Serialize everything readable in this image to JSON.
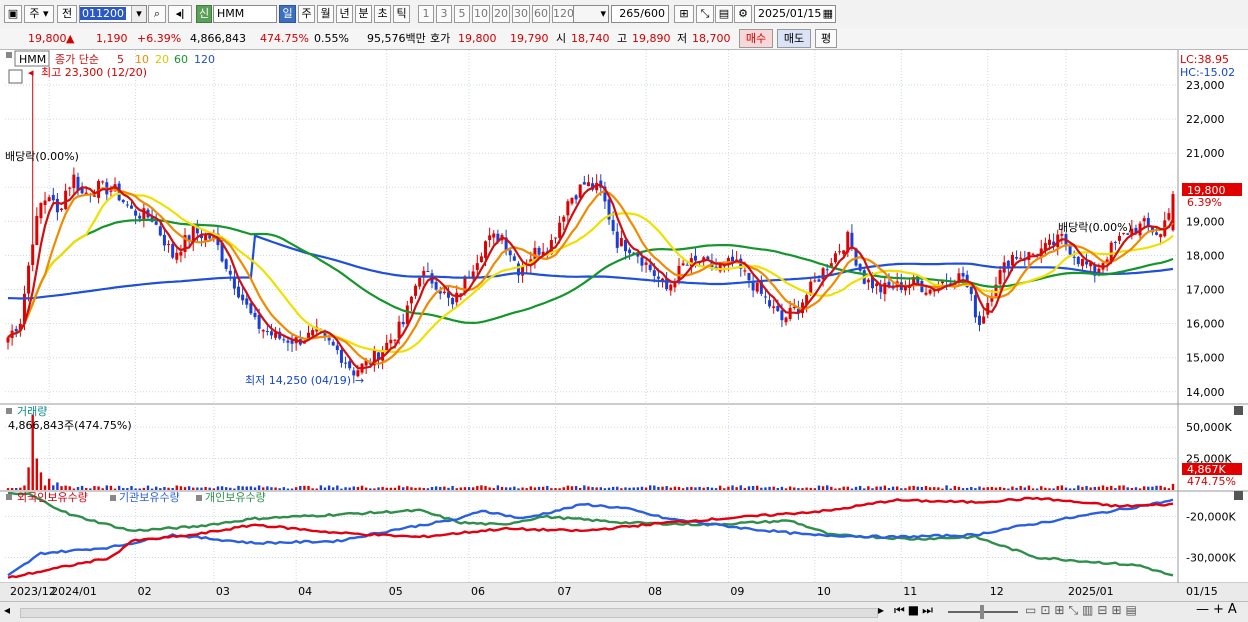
{
  "toolbar": {
    "market_label": "주",
    "prev_label": "전",
    "stock_code": "011200",
    "badge_label": "신",
    "stock_name": "HMM",
    "period_tabs": [
      "일",
      "주",
      "월",
      "년",
      "분",
      "초",
      "틱"
    ],
    "active_period": "일",
    "interval_buttons": [
      "1",
      "3",
      "5",
      "10",
      "20",
      "30",
      "60",
      "120"
    ],
    "count_value": "265",
    "count_max": "/600",
    "date_value": "2025/01/15"
  },
  "quote": {
    "price": "19,800",
    "change_arrow": "▲",
    "change": "1,190",
    "change_pct": "+6.39%",
    "volume": "4,866,843",
    "volume_ratio": "474.75%",
    "turnover": "0.55%",
    "amount": "95,576백만",
    "hoga_label": "호가",
    "ask": "19,800",
    "bid": "19,790",
    "open_label": "시",
    "open": "18,740",
    "high_label": "고",
    "high": "19,890",
    "low_label": "저",
    "low": "18,700",
    "buy_label": "매수",
    "sell_label": "매도",
    "eval_label": "평"
  },
  "colors": {
    "up": "#e00000",
    "down": "#1a3fd6",
    "ma5": "#d01010",
    "ma10": "#f08a00",
    "ma20": "#f0e000",
    "ma60": "#14962a",
    "ma120": "#2050d8",
    "foreign": "#e00010",
    "institution": "#2a5fe0",
    "individual": "#2f8f4a"
  },
  "chart_data": [
    {
      "type": "candlestick",
      "title": "HMM",
      "legend": [
        "종가 단순",
        "5",
        "10",
        "20",
        "60",
        "120"
      ],
      "corner_labels": [
        "LC:38.95",
        "HC:-15.02"
      ],
      "ylim": [
        13700,
        23500
      ],
      "yticks": [
        14000,
        15000,
        16000,
        17000,
        18000,
        19000,
        20000,
        21000,
        22000,
        23000
      ],
      "ytick_labels": [
        "14,000",
        "15,000",
        "16,000",
        "17,000",
        "18,000",
        "19,000",
        "20,000",
        "21,000",
        "22,000",
        "23,000"
      ],
      "annotations": {
        "high": "최고 23,300 (12/20)",
        "low": "최저 14,250 (04/19)",
        "dividend1": "배당락(0.00%)",
        "dividend2": "배당락(0.00%)"
      },
      "last_price_label": "19,800",
      "last_change_label": "6.39%",
      "months": [
        "2023/12",
        "2024/01",
        "02",
        "03",
        "04",
        "05",
        "06",
        "07",
        "08",
        "09",
        "10",
        "11",
        "12",
        "2025/01",
        "01/15"
      ],
      "close_anchors": [
        [
          0,
          15600
        ],
        [
          3,
          16100
        ],
        [
          6,
          18500
        ],
        [
          8,
          19500
        ],
        [
          10,
          19800
        ],
        [
          12,
          19200
        ],
        [
          14,
          19900
        ],
        [
          16,
          20300
        ],
        [
          18,
          19800
        ],
        [
          22,
          20000
        ],
        [
          26,
          19900
        ],
        [
          30,
          19300
        ],
        [
          35,
          19100
        ],
        [
          40,
          18000
        ],
        [
          45,
          18700
        ],
        [
          50,
          18500
        ],
        [
          55,
          17200
        ],
        [
          60,
          16000
        ],
        [
          65,
          15600
        ],
        [
          70,
          15500
        ],
        [
          75,
          15700
        ],
        [
          80,
          15200
        ],
        [
          84,
          14600
        ],
        [
          88,
          14900
        ],
        [
          92,
          15400
        ],
        [
          96,
          16000
        ],
        [
          100,
          17500
        ],
        [
          104,
          17200
        ],
        [
          108,
          16500
        ],
        [
          112,
          17500
        ],
        [
          116,
          18400
        ],
        [
          120,
          18600
        ],
        [
          124,
          17600
        ],
        [
          128,
          18100
        ],
        [
          132,
          18400
        ],
        [
          136,
          19600
        ],
        [
          140,
          20100
        ],
        [
          144,
          19900
        ],
        [
          148,
          18400
        ],
        [
          152,
          18200
        ],
        [
          156,
          17600
        ],
        [
          160,
          17000
        ],
        [
          164,
          17700
        ],
        [
          168,
          17800
        ],
        [
          172,
          17600
        ],
        [
          176,
          17800
        ],
        [
          180,
          17300
        ],
        [
          184,
          16700
        ],
        [
          188,
          16100
        ],
        [
          192,
          16500
        ],
        [
          196,
          17200
        ],
        [
          200,
          17900
        ],
        [
          204,
          18500
        ],
        [
          208,
          17300
        ],
        [
          212,
          17000
        ],
        [
          216,
          17100
        ],
        [
          220,
          17200
        ],
        [
          224,
          17000
        ],
        [
          228,
          17300
        ],
        [
          232,
          17400
        ],
        [
          236,
          16000
        ],
        [
          240,
          17300
        ],
        [
          244,
          18000
        ],
        [
          248,
          18000
        ],
        [
          252,
          18200
        ],
        [
          256,
          18500
        ],
        [
          260,
          17900
        ],
        [
          264,
          17500
        ],
        [
          268,
          18200
        ],
        [
          272,
          18700
        ],
        [
          276,
          18900
        ],
        [
          280,
          18600
        ],
        [
          283,
          19800
        ]
      ]
    },
    {
      "type": "bar",
      "title": "거래량",
      "value_label": "4,866,843주(474.75%)",
      "yticks": [
        25000,
        50000
      ],
      "ytick_labels": [
        "25,000K",
        "50,000K"
      ],
      "last_label": "4,867K",
      "last_pct": "474.75%",
      "spikes": [
        [
          5,
          18000
        ],
        [
          6,
          60000
        ],
        [
          7,
          25000
        ],
        [
          8,
          14000
        ],
        [
          10,
          9000
        ],
        [
          12,
          6000
        ]
      ],
      "base_volume": 2200
    },
    {
      "type": "line",
      "series_names": [
        "외국인보유수량",
        "기관보유수량",
        "개인보유수량"
      ],
      "yticks": [
        -20000,
        -30000
      ],
      "ytick_labels": [
        "-20,000K",
        "-30,000K"
      ],
      "ylim": [
        -36000,
        -14000
      ],
      "foreign": [
        [
          0,
          -35000
        ],
        [
          10,
          -33000
        ],
        [
          25,
          -30000
        ],
        [
          30,
          -26000
        ],
        [
          45,
          -24500
        ],
        [
          60,
          -22000
        ],
        [
          80,
          -24000
        ],
        [
          100,
          -25000
        ],
        [
          120,
          -23000
        ],
        [
          140,
          -23500
        ],
        [
          160,
          -21500
        ],
        [
          180,
          -20000
        ],
        [
          200,
          -18500
        ],
        [
          215,
          -16000
        ],
        [
          235,
          -16500
        ],
        [
          250,
          -15500
        ],
        [
          270,
          -17500
        ],
        [
          283,
          -17000
        ]
      ],
      "institution": [
        [
          0,
          -34500
        ],
        [
          8,
          -29000
        ],
        [
          25,
          -27500
        ],
        [
          40,
          -24500
        ],
        [
          60,
          -26500
        ],
        [
          80,
          -26000
        ],
        [
          95,
          -23000
        ],
        [
          110,
          -20500
        ],
        [
          115,
          -18500
        ],
        [
          125,
          -20500
        ],
        [
          140,
          -17000
        ],
        [
          150,
          -18000
        ],
        [
          160,
          -20500
        ],
        [
          180,
          -23000
        ],
        [
          195,
          -24500
        ],
        [
          215,
          -25000
        ],
        [
          235,
          -24500
        ],
        [
          245,
          -22500
        ],
        [
          260,
          -20000
        ],
        [
          275,
          -17500
        ],
        [
          283,
          -16000
        ]
      ],
      "individual": [
        [
          0,
          -14500
        ],
        [
          5,
          -14500
        ],
        [
          15,
          -19500
        ],
        [
          30,
          -23500
        ],
        [
          45,
          -22500
        ],
        [
          60,
          -20500
        ],
        [
          80,
          -19500
        ],
        [
          100,
          -18500
        ],
        [
          110,
          -21500
        ],
        [
          120,
          -22000
        ],
        [
          130,
          -20000
        ],
        [
          150,
          -21500
        ],
        [
          170,
          -22000
        ],
        [
          190,
          -21000
        ],
        [
          200,
          -24500
        ],
        [
          220,
          -25500
        ],
        [
          235,
          -25000
        ],
        [
          250,
          -30000
        ],
        [
          275,
          -32000
        ],
        [
          283,
          -34500
        ]
      ]
    }
  ]
}
